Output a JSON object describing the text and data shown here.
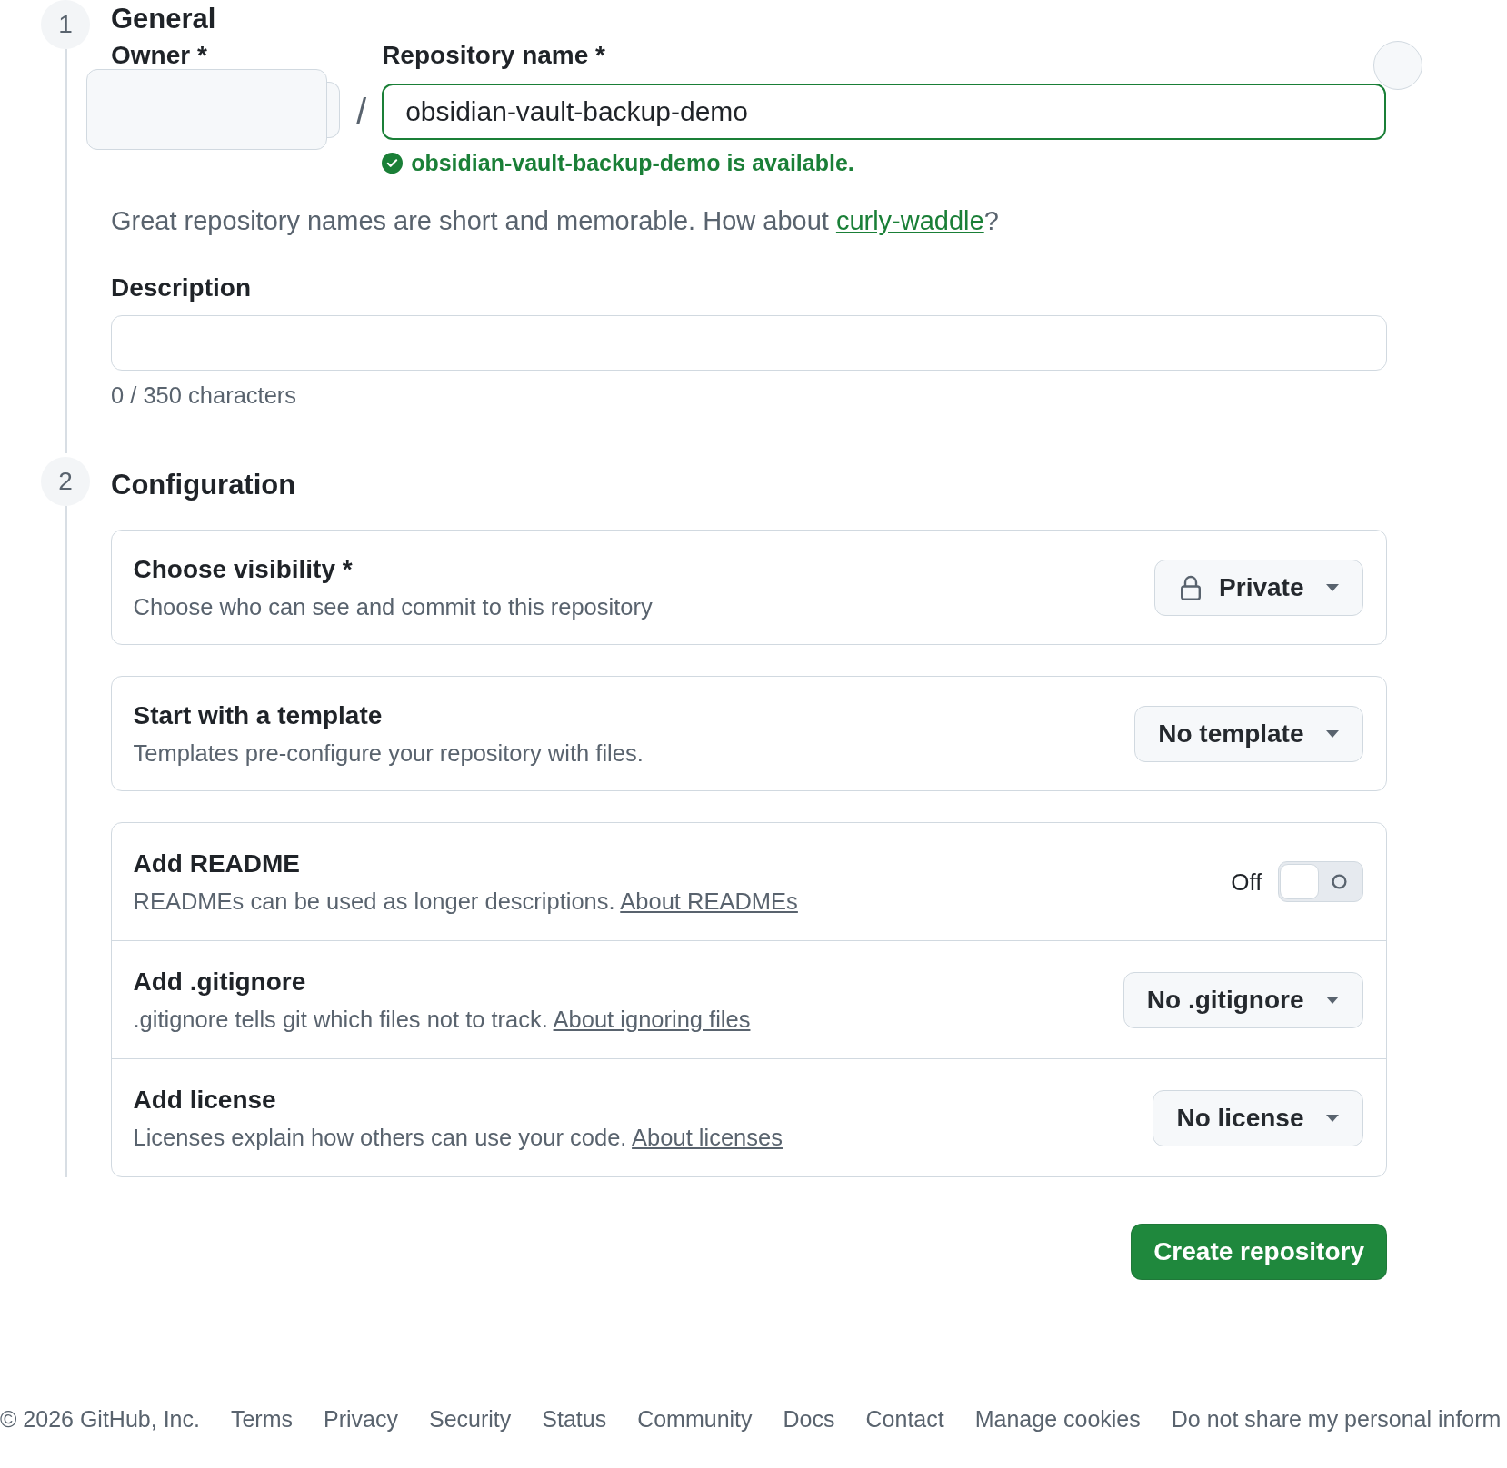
{
  "general": {
    "step": "1",
    "title": "General",
    "owner": {
      "label": "Owner *"
    },
    "separator": "/",
    "repository_name": {
      "label": "Repository name *",
      "value": "obsidian-vault-backup-demo",
      "available": true,
      "message": "obsidian-vault-backup-demo is available."
    },
    "suggestion": {
      "text": "Great repository names are short and memorable. How about",
      "link": "curly-waddle",
      "end": "?"
    },
    "description": {
      "label": "Description",
      "char_count": "0 / 350 characters"
    }
  },
  "configuration": {
    "step": "2",
    "title": "Configuration",
    "groups": [
      {
        "rows": [
          {
            "kind": "visibility",
            "title": "Choose visibility *",
            "description": "Choose who can see and commit to this repository",
            "value": "Private"
          }
        ]
      },
      {
        "rows": [
          {
            "kind": "select",
            "title": "Start with a template",
            "description": "Templates pre-configure your repository with files.",
            "value": "No template"
          }
        ]
      },
      {
        "rows": [
          {
            "kind": "toggle",
            "title": "Add README",
            "description": "READMEs can be used as longer descriptions.",
            "link": "About READMEs",
            "on": false,
            "state_label": "Off"
          },
          {
            "kind": "select",
            "title": "Add .gitignore",
            "description": ".gitignore tells git which files not to track.",
            "link": "About ignoring files",
            "value": "No .gitignore"
          },
          {
            "kind": "select",
            "title": "Add license",
            "description": "Licenses explain how others can use your code.",
            "link": "About licenses",
            "value": "No license"
          }
        ]
      }
    ]
  },
  "submit_button": "Create repository",
  "footer": {
    "copyright": "© 2026 GitHub, Inc.",
    "links": [
      "Terms",
      "Privacy",
      "Security",
      "Status",
      "Community",
      "Docs",
      "Contact",
      "Manage cookies",
      "Do not share my personal inform"
    ]
  }
}
